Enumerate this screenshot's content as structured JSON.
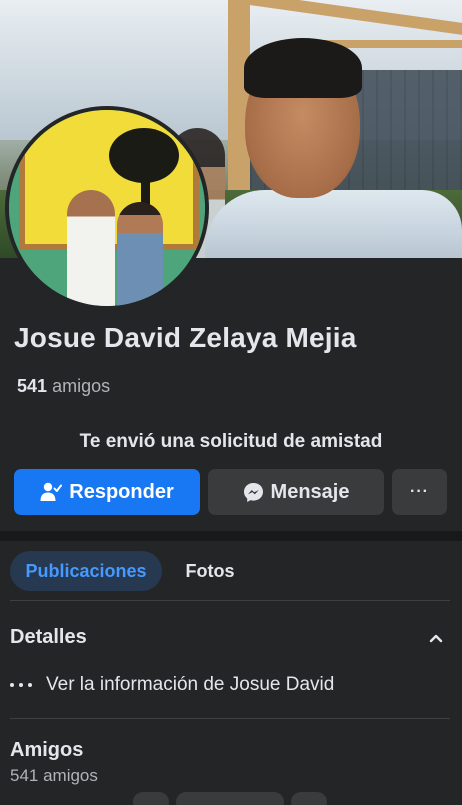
{
  "profile": {
    "name": "Josue David Zelaya Mejia",
    "friends_count": "541",
    "friends_word": "amigos"
  },
  "request": {
    "text": "Te envió una solicitud de amistad"
  },
  "actions": {
    "respond_label": "Responder",
    "respond_icon": "person-check-icon",
    "message_label": "Mensaje",
    "message_icon": "messenger-icon",
    "more_label": "···"
  },
  "tabs": [
    {
      "label": "Publicaciones",
      "active": true
    },
    {
      "label": "Fotos",
      "active": false
    }
  ],
  "details": {
    "title": "Detalles",
    "info_label": "Ver la información de Josue David"
  },
  "friends_section": {
    "title": "Amigos",
    "count_label": "541 amigos"
  },
  "colors": {
    "background": "#242526",
    "primary": "#1877f2",
    "secondary_button": "#3a3b3c",
    "active_tab_bg": "#263951",
    "active_tab_text": "#4599ff"
  }
}
